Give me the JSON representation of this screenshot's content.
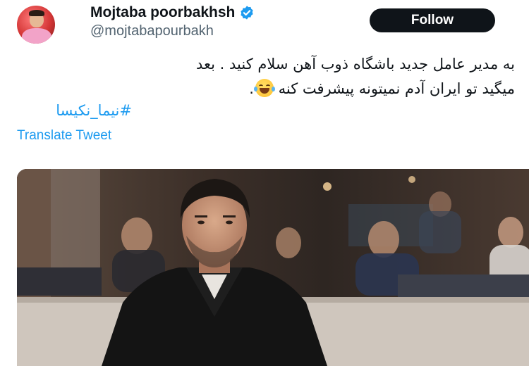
{
  "author": {
    "display_name": "Mojtaba poorbakhsh",
    "handle": "@mojtabapourbakh",
    "verified": true,
    "avatar_icon": "avatar-photo"
  },
  "actions": {
    "follow_label": "Follow"
  },
  "tweet": {
    "lines": [
      "به مدیر عامل جدید باشگاه ذوب آهن سلام کنید . بعد",
      "میگید تو ایران آدم نمیتونه پیشرفت کنه"
    ],
    "line2_suffix": ".",
    "emoji": "face-with-tears-of-joy",
    "hashtag": "#نیما_نکیسا",
    "translate_label": "Translate Tweet"
  },
  "media": {
    "type": "photo",
    "description_icon": "man-in-black-suit-photo"
  },
  "colors": {
    "link_blue": "#1d9bf0",
    "verified_blue": "#1d9bf0",
    "follow_bg": "#0f1419",
    "secondary_text": "#536471"
  }
}
